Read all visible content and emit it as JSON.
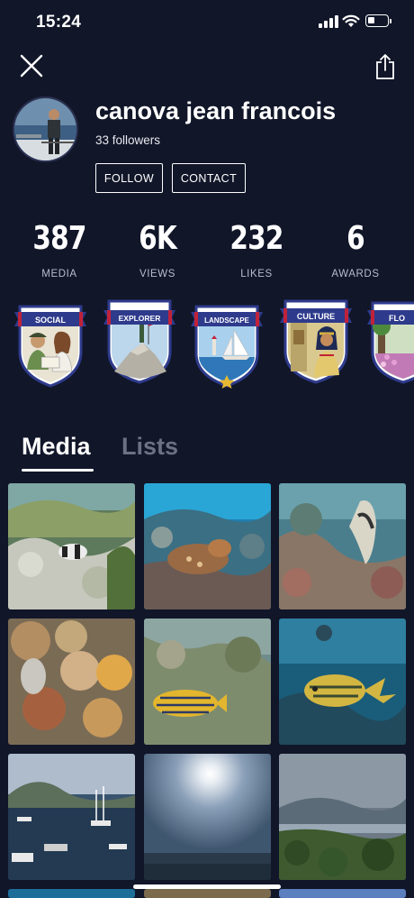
{
  "status_bar": {
    "time": "15:24",
    "battery_level": 0.35
  },
  "icons": {
    "close": "close-icon",
    "share": "share-icon"
  },
  "profile": {
    "name": "canova jean francois",
    "followers": "33 followers",
    "follow_label": "FOLLOW",
    "contact_label": "CONTACT"
  },
  "stats": [
    {
      "value": "387",
      "label": "MEDIA"
    },
    {
      "value": "6K",
      "label": "VIEWS"
    },
    {
      "value": "232",
      "label": "LIKES"
    },
    {
      "value": "6",
      "label": "AWARDS"
    }
  ],
  "badges": [
    {
      "label": "SOCIAL",
      "theme": "social"
    },
    {
      "label": "EXPLORER",
      "theme": "explorer"
    },
    {
      "label": "LANDSCAPE",
      "theme": "landscape"
    },
    {
      "label": "CULTURE",
      "theme": "culture"
    },
    {
      "label": "FLO",
      "theme": "flora"
    }
  ],
  "tabs": {
    "media": "Media",
    "lists": "Lists",
    "active": "media"
  },
  "colors": {
    "background": "#111629",
    "badge_banner": "#2e3b8c",
    "badge_accent": "#c0223a",
    "inactive_tab": "#6c7183"
  }
}
